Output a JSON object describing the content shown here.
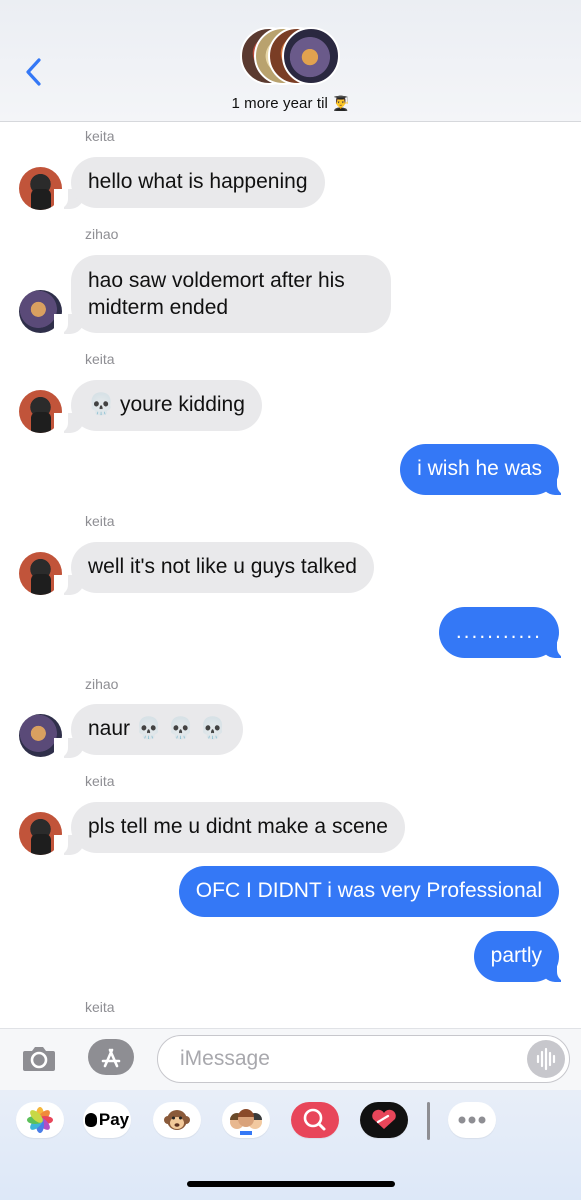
{
  "header": {
    "group_title": "1 more year til",
    "title_emoji": "👨‍🎓",
    "back_icon": "chevron-left-icon"
  },
  "messages": [
    {
      "sender": "keita",
      "text": "hello what is happening",
      "direction": "incoming"
    },
    {
      "sender": "zihao",
      "text": "hao saw voldemort after his midterm ended",
      "direction": "incoming"
    },
    {
      "sender": "keita",
      "text": "💀 youre kidding",
      "direction": "incoming"
    },
    {
      "sender": "",
      "text": "i wish he was",
      "direction": "outgoing"
    },
    {
      "sender": "keita",
      "text": "well it's not like u guys talked",
      "direction": "incoming"
    },
    {
      "sender": "",
      "text": "...........",
      "direction": "outgoing"
    },
    {
      "sender": "zihao",
      "text": "naur 💀 💀 💀",
      "direction": "incoming"
    },
    {
      "sender": "keita",
      "text": "pls tell me u didnt make a scene",
      "direction": "incoming"
    },
    {
      "sender": "",
      "text": "OFC I DIDNT i was very Professional",
      "direction": "outgoing"
    },
    {
      "sender": "",
      "text": "partly",
      "direction": "outgoing"
    },
    {
      "sender": "keita",
      "text": "",
      "direction": "incoming"
    }
  ],
  "input": {
    "placeholder": "iMessage"
  },
  "drawer": {
    "apple_pay_label": "Pay",
    "apps": [
      "photos-icon",
      "apple-pay-icon",
      "memoji-monkey-icon",
      "memoji-group-icon",
      "image-search-icon",
      "digital-touch-icon",
      "more-icon"
    ]
  },
  "colors": {
    "outgoing_bubble": "#3478f6",
    "incoming_bubble": "#e9e9eb",
    "accent": "#3478f6"
  }
}
